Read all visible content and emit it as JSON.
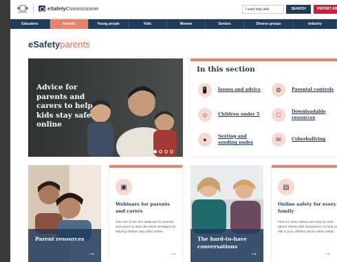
{
  "header": {
    "logo_text_bold": "eSafety",
    "logo_text_light": "Commissioner",
    "help_placeholder": "I want help with",
    "search_label": "SEARCH",
    "report_label": "REPORT ABUSE"
  },
  "nav": {
    "items": [
      "Educators",
      "Parents",
      "Young people",
      "Kids",
      "Women",
      "Seniors",
      "Diverse groups",
      "Industry"
    ],
    "active": "Parents"
  },
  "brand": {
    "bold": "eSafety",
    "light": "parents"
  },
  "hero": {
    "text": "Advice for parents and carers to help kids stay safe online"
  },
  "in_section": {
    "title": "In this section",
    "items": [
      {
        "label": "Issues and advice",
        "icon": "phone-icon"
      },
      {
        "label": "Parental controls",
        "icon": "settings-device-icon"
      },
      {
        "label": "Children under 5",
        "icon": "children-icon"
      },
      {
        "label": "Downloadable resources",
        "icon": "monitor-icon"
      },
      {
        "label": "Sexting and sending nudes",
        "icon": "person-icon"
      },
      {
        "label": "Cyberbullying",
        "icon": "chat-device-icon"
      }
    ]
  },
  "cards": {
    "parent_resources": {
      "title": "Parent resources"
    },
    "webinars": {
      "title": "Webinars for parents and carers",
      "body": "Join one of our free webinars for parents and carers to learn the latest strategies for helping children stay safer online."
    },
    "hard_conversations": {
      "title": "The hard-to-have conversations"
    },
    "online_safety": {
      "title": "Online safety for every family",
      "body": "Find our short videos and easy-to-read advice sheets with translations, to help you talk to your children about online safety."
    }
  },
  "colors": {
    "navy": "#1f3b5c",
    "coral": "#e8826a",
    "red": "#c7243a"
  }
}
